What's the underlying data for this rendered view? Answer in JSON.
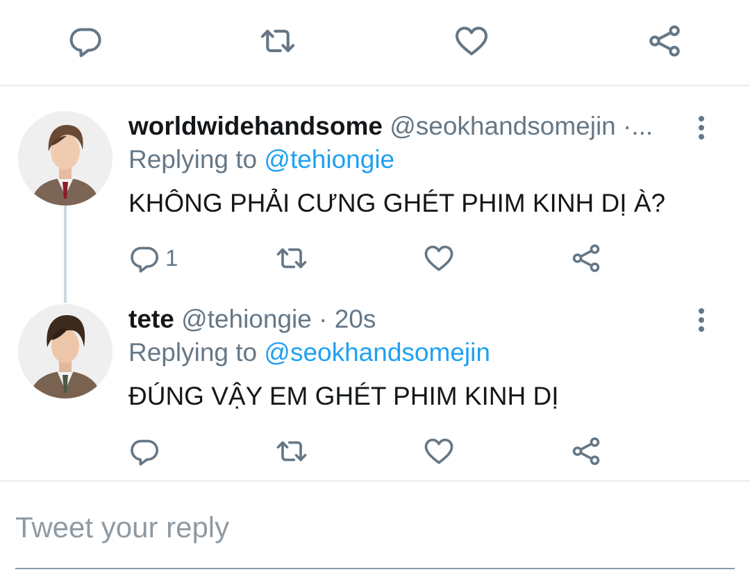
{
  "top_actions": {
    "icons": [
      "reply-icon",
      "retweet-icon",
      "like-icon",
      "share-icon"
    ]
  },
  "tweets": [
    {
      "display_name": "worldwidehandsome",
      "handle": "@seokhandsomejin",
      "meta_suffix": " ·...",
      "replying_prefix": "Replying to ",
      "replying_to": "@tehiongie",
      "text": "KHÔNG PHẢI CƯNG GHÉT PHIM KINH DỊ À?",
      "reply_count": "1"
    },
    {
      "display_name": "tete",
      "handle": "@tehiongie",
      "meta_suffix": " · 20s",
      "replying_prefix": "Replying to ",
      "replying_to": "@seokhandsomejin",
      "text": "ĐÚNG VẬY EM GHÉT PHIM KINH DỊ",
      "reply_count": ""
    }
  ],
  "composer": {
    "placeholder": "Tweet your reply"
  },
  "colors": {
    "link": "#1da1f2",
    "secondary_text": "#657786",
    "divider": "#e6ecf0"
  }
}
